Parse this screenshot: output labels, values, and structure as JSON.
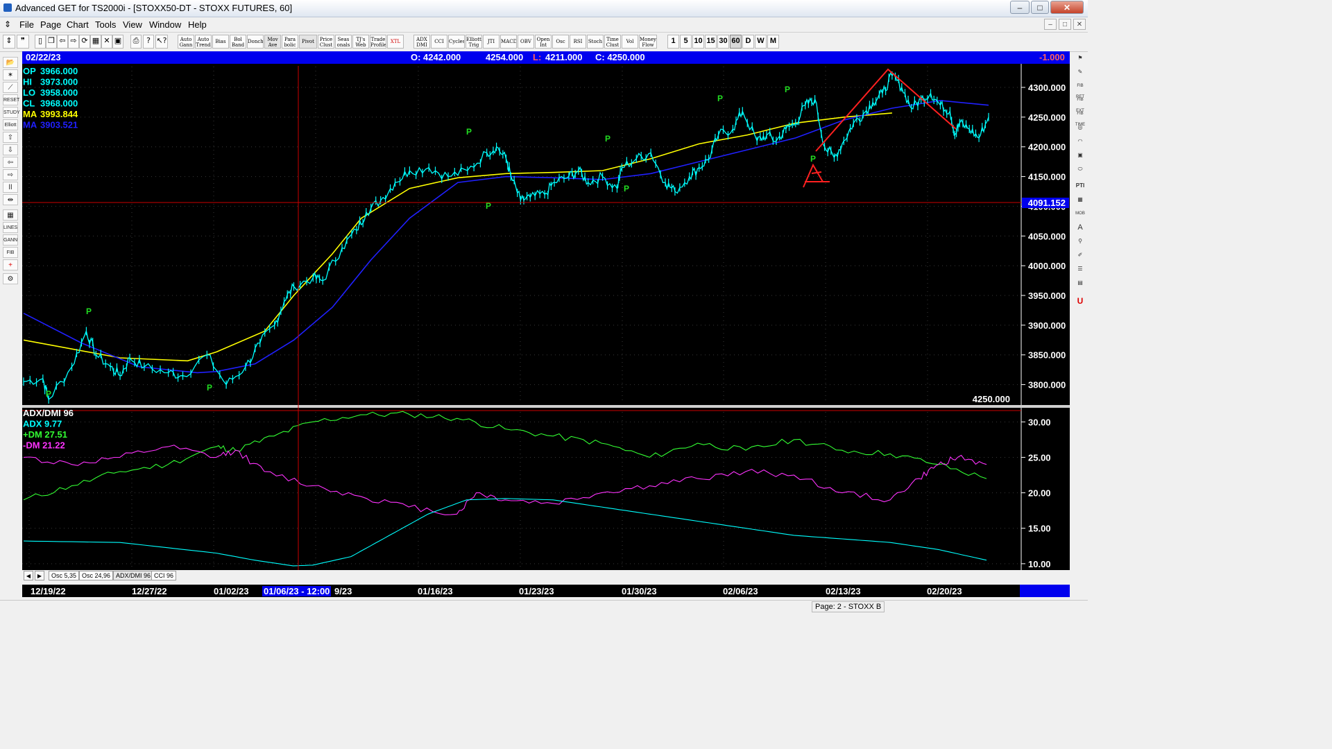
{
  "window": {
    "title": "Advanced GET for TS2000i - [STOXX50-DT - STOXX FUTURES, 60]",
    "buttons": [
      "–",
      "□",
      "✕"
    ]
  },
  "menu": [
    "File",
    "Page",
    "Chart",
    "Tools",
    "View",
    "Window",
    "Help"
  ],
  "toolbar": {
    "studies": [
      "Auto Gann",
      "Auto Trend",
      "Bias",
      "Bol Band",
      "Donch",
      "Mov Ave",
      "Para bolic",
      "Pivot",
      "Price Clust",
      "Seas onals",
      "TJ's Web",
      "Trade Profile",
      "XTL",
      "ADX DMI",
      "CCI",
      "Cycles",
      "Elliott Trig",
      "JTI",
      "MACD",
      "OBV",
      "Open Int",
      "Osc",
      "RSI",
      "Stoch",
      "Time Clust",
      "Vol",
      "Money Flow"
    ],
    "periods": [
      "1",
      "5",
      "10",
      "15",
      "30",
      "60",
      "D",
      "W",
      "M"
    ],
    "selected_period": "60"
  },
  "infobar": {
    "date": "02/22/23",
    "open": "O: 4242.000",
    "high": "4254.000",
    "low_label": "L:",
    "low": "4211.000",
    "close": "C: 4250.000",
    "change": "-1.000"
  },
  "price_legend": [
    {
      "label": "OP",
      "value": "3966.000",
      "color": "#00ffff"
    },
    {
      "label": "HI",
      "value": "3973.000",
      "color": "#00ffff"
    },
    {
      "label": "LO",
      "value": "3958.000",
      "color": "#00ffff"
    },
    {
      "label": "CL",
      "value": "3968.000",
      "color": "#00ffff"
    },
    {
      "label": "MA",
      "value": "3993.844",
      "color": "#ffff00"
    },
    {
      "label": "MA",
      "value": "3903.521",
      "color": "#2020ff"
    }
  ],
  "cursor_price": "4091.152",
  "last_price_label": "4250.000",
  "pivot_marker": "P",
  "indicator_legend": [
    {
      "text": "ADX/DMI 96",
      "color": "#ffffff"
    },
    {
      "text": "ADX 9.77",
      "color": "#00ffff"
    },
    {
      "text": "+DM 27.51",
      "color": "#33ff33"
    },
    {
      "text": "-DM 21.22",
      "color": "#ff33ff"
    }
  ],
  "tabs": [
    "Osc 5,35",
    "Osc 24,96",
    "ADX/DMI 96",
    "CCI 96"
  ],
  "selected_tab": "ADX/DMI 96",
  "date_axis": {
    "labels": [
      "12/19/22",
      "12/27/22",
      "01/02/23",
      "01/06/23 - 12:00",
      "9/23",
      "01/16/23",
      "01/23/23",
      "01/30/23",
      "02/06/23",
      "02/13/23",
      "02/20/23"
    ],
    "cursor_label": "01/06/23 - 12:00"
  },
  "status": {
    "page": "Page: 2 - STOXX B"
  },
  "chart_data": [
    {
      "type": "line",
      "title": "STOXX50-DT - STOXX FUTURES, 60",
      "y_ticks": [
        "4300.000",
        "4250.000",
        "4200.000",
        "4150.000",
        "4100.000",
        "4050.000",
        "4000.000",
        "3950.000",
        "3900.000",
        "3850.000",
        "3800.000"
      ],
      "ylim": [
        3768,
        4335
      ],
      "x_dates": [
        "12/19/22",
        "12/27/22",
        "01/02/23",
        "01/06/23",
        "01/16/23",
        "01/23/23",
        "01/30/23",
        "02/06/23",
        "02/13/23",
        "02/20/23",
        "02/22/23"
      ],
      "series": [
        {
          "name": "Price",
          "color": "#00ffff",
          "x": [
            0,
            0.02,
            0.026,
            0.05,
            0.065,
            0.075,
            0.09,
            0.1,
            0.11,
            0.125,
            0.15,
            0.165,
            0.19,
            0.21,
            0.23,
            0.245,
            0.26,
            0.27,
            0.28,
            0.3,
            0.31,
            0.33,
            0.345,
            0.355,
            0.37,
            0.385,
            0.4,
            0.42,
            0.44,
            0.46,
            0.48,
            0.49,
            0.5,
            0.505,
            0.515,
            0.525,
            0.54,
            0.55,
            0.565,
            0.575,
            0.585,
            0.6,
            0.615,
            0.62,
            0.635,
            0.65,
            0.665,
            0.675,
            0.69,
            0.7,
            0.71,
            0.72,
            0.735,
            0.745,
            0.76,
            0.77,
            0.78,
            0.79,
            0.8,
            0.81,
            0.82,
            0.83,
            0.84,
            0.85,
            0.86,
            0.87,
            0.88,
            0.89,
            0.9,
            0.91,
            0.92,
            0.93,
            0.94,
            0.95,
            0.96,
            0.965,
            0.97,
            0.98,
            0.99,
            1.0
          ],
          "values": [
            3805,
            3810,
            3775,
            3830,
            3890,
            3850,
            3830,
            3815,
            3845,
            3830,
            3820,
            3815,
            3850,
            3800,
            3830,
            3870,
            3900,
            3940,
            3965,
            3980,
            3975,
            4030,
            4060,
            4090,
            4110,
            4140,
            4160,
            4165,
            4150,
            4160,
            4190,
            4200,
            4180,
            4150,
            4110,
            4115,
            4120,
            4140,
            4150,
            4160,
            4140,
            4150,
            4130,
            4165,
            4180,
            4190,
            4140,
            4125,
            4150,
            4165,
            4180,
            4220,
            4230,
            4260,
            4210,
            4220,
            4210,
            4230,
            4240,
            4270,
            4280,
            4200,
            4182,
            4210,
            4240,
            4255,
            4275,
            4290,
            4320,
            4300,
            4265,
            4280,
            4290,
            4270,
            4260,
            4220,
            4240,
            4230,
            4215,
            4250
          ]
        },
        {
          "name": "MA 3993.844",
          "color": "#ffff00",
          "x": [
            0,
            0.1,
            0.17,
            0.2,
            0.25,
            0.28,
            0.32,
            0.35,
            0.4,
            0.45,
            0.5,
            0.55,
            0.6,
            0.65,
            0.7,
            0.75,
            0.8,
            0.85,
            0.9
          ],
          "values": [
            3875,
            3845,
            3840,
            3855,
            3890,
            3950,
            4020,
            4080,
            4130,
            4148,
            4155,
            4157,
            4160,
            4180,
            4205,
            4220,
            4240,
            4250,
            4257
          ]
        },
        {
          "name": "MA 3903.521",
          "color": "#2020ff",
          "x": [
            0,
            0.06,
            0.12,
            0.18,
            0.2,
            0.24,
            0.28,
            0.32,
            0.36,
            0.4,
            0.45,
            0.5,
            0.55,
            0.6,
            0.65,
            0.7,
            0.75,
            0.8,
            0.85,
            0.9,
            0.95,
            1.0
          ],
          "values": [
            3920,
            3870,
            3830,
            3820,
            3822,
            3835,
            3875,
            3930,
            4010,
            4080,
            4140,
            4150,
            4148,
            4145,
            4155,
            4175,
            4195,
            4215,
            4245,
            4265,
            4278,
            4270
          ]
        }
      ]
    },
    {
      "type": "line",
      "title": "ADX/DMI 96",
      "y_ticks": [
        "30.00",
        "25.00",
        "20.00",
        "15.00",
        "10.00"
      ],
      "ylim": [
        9.3,
        31.4
      ],
      "series": [
        {
          "name": "+DM",
          "color": "#33ff33",
          "x": [
            0,
            0.05,
            0.1,
            0.15,
            0.2,
            0.22,
            0.26,
            0.3,
            0.35,
            0.4,
            0.45,
            0.5,
            0.55,
            0.6,
            0.65,
            0.7,
            0.75,
            0.8,
            0.85,
            0.9,
            0.95,
            1.0
          ],
          "values": [
            19,
            21,
            23,
            24,
            26.5,
            26,
            28,
            30,
            31,
            31.1,
            30.5,
            29,
            28,
            27,
            25,
            27,
            26,
            27.5,
            26,
            25.5,
            24,
            22
          ]
        },
        {
          "name": "-DM",
          "color": "#ff33ff",
          "x": [
            0,
            0.05,
            0.1,
            0.15,
            0.2,
            0.22,
            0.25,
            0.3,
            0.35,
            0.4,
            0.45,
            0.47,
            0.5,
            0.55,
            0.6,
            0.65,
            0.7,
            0.75,
            0.8,
            0.85,
            0.9,
            0.93,
            0.95,
            0.97,
            1.0
          ],
          "values": [
            25,
            24,
            25,
            26.5,
            25,
            26,
            23,
            21,
            19.5,
            18,
            17,
            20,
            19,
            18.5,
            20,
            21,
            22,
            23,
            22.5,
            20,
            19,
            22,
            24,
            25,
            24
          ]
        },
        {
          "name": "ADX",
          "color": "#00ffff",
          "x": [
            0,
            0.1,
            0.2,
            0.24,
            0.28,
            0.3,
            0.34,
            0.38,
            0.42,
            0.46,
            0.5,
            0.55,
            0.6,
            0.65,
            0.7,
            0.75,
            0.8,
            0.85,
            0.9,
            0.95,
            1.0
          ],
          "values": [
            13.2,
            13,
            11.5,
            10.5,
            9.7,
            9.8,
            11,
            14,
            17,
            19,
            19.2,
            19,
            18,
            17,
            16,
            15,
            14,
            13.5,
            13,
            12,
            10.5
          ]
        }
      ]
    }
  ]
}
